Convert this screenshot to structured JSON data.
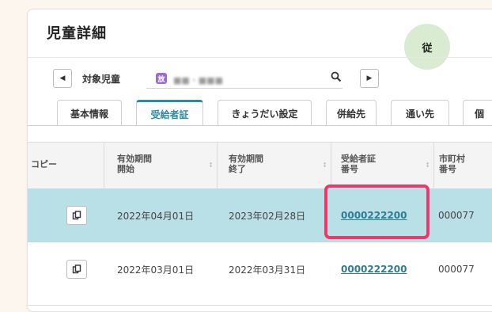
{
  "header": {
    "title": "児童詳細",
    "badge": "従"
  },
  "child_selector": {
    "label": "対象児童",
    "tag": "放",
    "name": "■■・■■■"
  },
  "tabs": [
    "基本情報",
    "受給者証",
    "きょうだい設定",
    "併給先",
    "通い先",
    "個"
  ],
  "active_tab": "受給者証",
  "table": {
    "columns": [
      {
        "line1": "コピー",
        "line2": ""
      },
      {
        "line1": "有効期間",
        "line2": "開始"
      },
      {
        "line1": "有効期間",
        "line2": "終了"
      },
      {
        "line1": "受給者証",
        "line2": "番号"
      },
      {
        "line1": "市町村",
        "line2": "番号"
      }
    ],
    "rows": [
      {
        "start": "2022年04月01日",
        "end": "2023年02月28日",
        "cert_no": "0000222200",
        "city_no": "000077"
      },
      {
        "start": "2022年03月01日",
        "end": "2022年03月31日",
        "cert_no": "0000222200",
        "city_no": "000077"
      }
    ]
  },
  "icons": {
    "prev": "caret-left-icon",
    "next": "caret-right-icon",
    "search": "search-icon",
    "copy": "copy-icon",
    "sort": "sort-icon"
  },
  "colors": {
    "accent": "#2d8aa0",
    "selected_row": "#b9e0e6",
    "highlight": "#ea3a6b",
    "badge_bg": "#d9ecd1",
    "child_tag": "#9b6bd0",
    "page_bg": "#fdf6ef"
  }
}
